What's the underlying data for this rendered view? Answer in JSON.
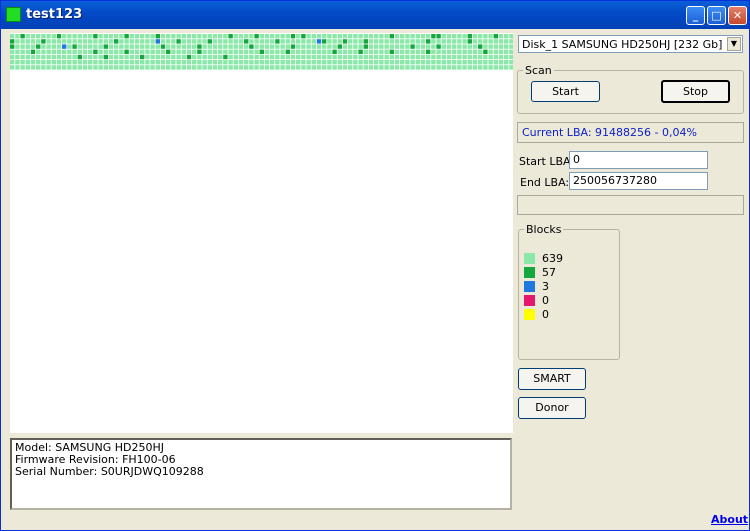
{
  "window": {
    "title": "test123"
  },
  "disk_select": {
    "value": "Disk_1 SAMSUNG HD250HJ [232 Gb]"
  },
  "scan": {
    "legend": "Scan",
    "start_label": "Start",
    "stop_label": "Stop"
  },
  "current_lba": "Current LBA: 91488256 - 0,04%",
  "range": {
    "start_label": "Start LBA:",
    "start_value": "0",
    "end_label": "End LBA:",
    "end_value": "250056737280"
  },
  "blocks": {
    "legend": "Blocks",
    "items": [
      {
        "color": "#8ce8a8",
        "count": "639"
      },
      {
        "color": "#14a83c",
        "count": "57"
      },
      {
        "color": "#1e78e0",
        "count": "3"
      },
      {
        "color": "#e6186e",
        "count": "0"
      },
      {
        "color": "#ffff00",
        "count": "0"
      }
    ]
  },
  "buttons": {
    "smart_label": "SMART",
    "donor_label": "Donor"
  },
  "drive_info": {
    "model": "Model: SAMSUNG HD250HJ",
    "firmware": "Firmware Revision: FH100-06",
    "serial": "Serial Number: S0URJDWQ109288"
  },
  "about_label": "About",
  "map": {
    "total_blocks": 699,
    "dark_blocks": [
      2,
      9,
      16,
      22,
      28,
      42,
      47,
      54,
      56,
      73,
      81,
      82,
      88,
      93,
      98,
      100,
      106,
      120,
      128,
      132,
      138,
      145,
      151,
      160,
      164,
      168,
      180,
      188,
      200,
      205,
      212,
      218,
      229,
      236,
      246,
      254,
      263,
      268,
      277,
      282,
      290,
      299,
      304,
      316,
      322,
      330,
      336,
      348,
      353,
      362,
      367,
      373,
      380,
      391,
      397,
      413,
      418,
      425,
      434,
      441
    ],
    "blue_blocks": [
      128,
      159,
      210
    ]
  }
}
